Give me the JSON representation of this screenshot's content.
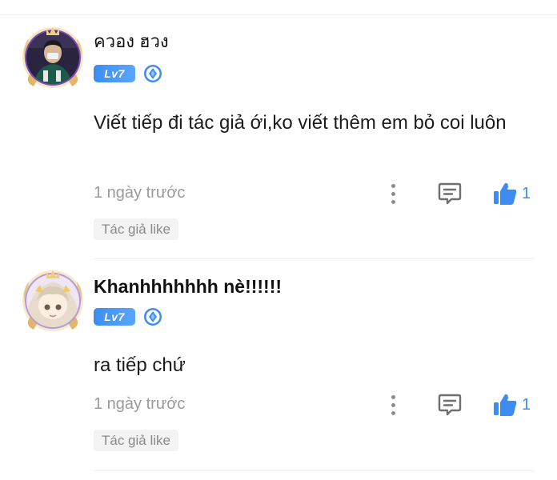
{
  "comments": [
    {
      "username": "ควอง ฮวง",
      "avatar_icon": "avatar-boy-icon",
      "level": "Lv7",
      "tier_icon": "sapphire-tier-icon",
      "text": "Viết tiếp đi tác giả ới,ko viết thêm em bỏ coi luôn",
      "timestamp": "1 ngày trước",
      "more_icon": "more-vertical-icon",
      "reply_icon": "comment-reply-icon",
      "like_icon": "thumbs-up-icon",
      "likes": "1",
      "author_tag": "Tác giả like"
    },
    {
      "username": "Khanhhhhhhh nè!!!!!!",
      "avatar_icon": "avatar-anime-girl-icon",
      "level": "Lv7",
      "tier_icon": "sapphire-tier-icon",
      "text": "ra tiếp chứ",
      "timestamp": "1 ngày trước",
      "more_icon": "more-vertical-icon",
      "reply_icon": "comment-reply-icon",
      "like_icon": "thumbs-up-icon",
      "likes": "1",
      "author_tag": "Tác giả like"
    }
  ],
  "colors": {
    "accent": "#3d8cf2",
    "muted_text": "#9a9a9a",
    "tag_bg": "#f3f3f3",
    "divider": "#ececec"
  }
}
